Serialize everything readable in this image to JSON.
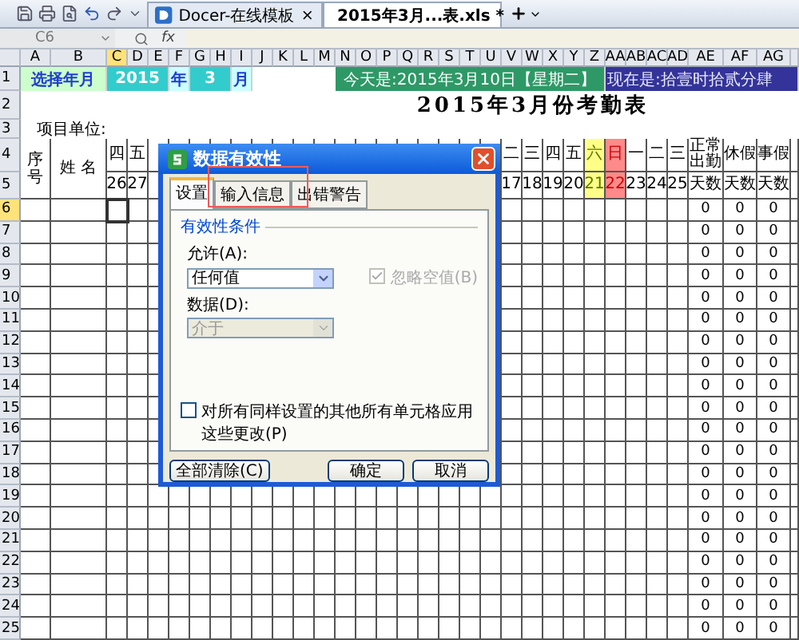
{
  "tabs": [
    {
      "label": "Docer-在线模板",
      "selected": false
    },
    {
      "label": "2015年3月...表.xls *",
      "selected": true
    }
  ],
  "name_box": "C6",
  "fx_label": "fx",
  "columns": [
    {
      "label": "A",
      "selected": false
    },
    {
      "label": "B",
      "selected": false
    },
    {
      "label": "C",
      "selected": true
    },
    {
      "label": "D",
      "selected": false
    },
    {
      "label": "E",
      "selected": false
    },
    {
      "label": "F",
      "selected": false
    },
    {
      "label": "G",
      "selected": false
    },
    {
      "label": "H",
      "selected": false
    },
    {
      "label": "I",
      "selected": false
    },
    {
      "label": "J",
      "selected": false
    },
    {
      "label": "K",
      "selected": false
    },
    {
      "label": "L",
      "selected": false
    },
    {
      "label": "M",
      "selected": false
    },
    {
      "label": "N",
      "selected": false
    },
    {
      "label": "O",
      "selected": false
    },
    {
      "label": "P",
      "selected": false
    },
    {
      "label": "Q",
      "selected": false
    },
    {
      "label": "R",
      "selected": false
    },
    {
      "label": "S",
      "selected": false
    },
    {
      "label": "T",
      "selected": false
    },
    {
      "label": "U",
      "selected": false
    },
    {
      "label": "V",
      "selected": false
    },
    {
      "label": "W",
      "selected": false
    },
    {
      "label": "X",
      "selected": false
    },
    {
      "label": "Y",
      "selected": false
    },
    {
      "label": "Z",
      "selected": false
    },
    {
      "label": "AA",
      "selected": false
    },
    {
      "label": "AB",
      "selected": false
    },
    {
      "label": "AC",
      "selected": false
    },
    {
      "label": "AD",
      "selected": false
    },
    {
      "label": "AE",
      "selected": false
    },
    {
      "label": "AF",
      "selected": false
    },
    {
      "label": "AG",
      "selected": false
    }
  ],
  "row_headers": [
    {
      "label": "1",
      "selected": false
    },
    {
      "label": "2",
      "selected": false
    },
    {
      "label": "3",
      "selected": false
    },
    {
      "label": "4",
      "selected": false
    },
    {
      "label": "5",
      "selected": false
    },
    {
      "label": "6",
      "selected": true
    },
    {
      "label": "7",
      "selected": false
    },
    {
      "label": "8",
      "selected": false
    },
    {
      "label": "9",
      "selected": false
    },
    {
      "label": "10",
      "selected": false
    },
    {
      "label": "11",
      "selected": false
    },
    {
      "label": "12",
      "selected": false
    },
    {
      "label": "13",
      "selected": false
    },
    {
      "label": "14",
      "selected": false
    },
    {
      "label": "15",
      "selected": false
    },
    {
      "label": "16",
      "selected": false
    },
    {
      "label": "17",
      "selected": false
    },
    {
      "label": "18",
      "selected": false
    },
    {
      "label": "19",
      "selected": false
    },
    {
      "label": "20",
      "selected": false
    },
    {
      "label": "21",
      "selected": false
    },
    {
      "label": "22",
      "selected": false
    },
    {
      "label": "23",
      "selected": false
    },
    {
      "label": "24",
      "selected": false
    },
    {
      "label": "25",
      "selected": false
    }
  ],
  "top_row": {
    "label": "选择年月",
    "year": "2015",
    "year_unit": "年",
    "month": "3",
    "month_unit": "月",
    "today": "今天是:2015年3月10日【星期二】",
    "now": "现在是:拾壹时拾贰分肆"
  },
  "title": "2015年3月份考勤表",
  "unit_label": "项目单位:",
  "seq_header": "序号",
  "name_header": "姓 名",
  "days_start": [
    {
      "weekday": "四",
      "date": "26",
      "kind": "weekday"
    },
    {
      "weekday": "五",
      "date": "27",
      "kind": "weekday"
    }
  ],
  "days_end": [
    {
      "weekday": "二",
      "date": "17",
      "kind": "weekday"
    },
    {
      "weekday": "三",
      "date": "18",
      "kind": "weekday"
    },
    {
      "weekday": "四",
      "date": "19",
      "kind": "weekday"
    },
    {
      "weekday": "五",
      "date": "20",
      "kind": "weekday"
    },
    {
      "weekday": "六",
      "date": "21",
      "kind": "saturday"
    },
    {
      "weekday": "日",
      "date": "22",
      "kind": "sunday"
    },
    {
      "weekday": "一",
      "date": "23",
      "kind": "weekday"
    },
    {
      "weekday": "二",
      "date": "24",
      "kind": "weekday"
    },
    {
      "weekday": "三",
      "date": "25",
      "kind": "weekday"
    }
  ],
  "summary_columns": [
    {
      "title": "正常出勤",
      "unit": "天数"
    },
    {
      "title": "休假",
      "unit": "天数"
    },
    {
      "title": "事假",
      "unit": "天数"
    }
  ],
  "records": [
    {
      "counts": [
        "0",
        "0",
        "0"
      ]
    },
    {
      "counts": [
        "0",
        "0",
        "0"
      ]
    },
    {
      "counts": [
        "0",
        "0",
        "0"
      ]
    },
    {
      "counts": [
        "0",
        "0",
        "0"
      ]
    },
    {
      "counts": [
        "0",
        "0",
        "0"
      ]
    },
    {
      "counts": [
        "0",
        "0",
        "0"
      ]
    },
    {
      "counts": [
        "0",
        "0",
        "0"
      ]
    },
    {
      "counts": [
        "0",
        "0",
        "0"
      ]
    },
    {
      "counts": [
        "0",
        "0",
        "0"
      ]
    },
    {
      "counts": [
        "0",
        "0",
        "0"
      ]
    },
    {
      "counts": [
        "0",
        "0",
        "0"
      ]
    },
    {
      "counts": [
        "0",
        "0",
        "0"
      ]
    },
    {
      "counts": [
        "0",
        "0",
        "0"
      ]
    },
    {
      "counts": [
        "0",
        "0",
        "0"
      ]
    },
    {
      "counts": [
        "0",
        "0",
        "0"
      ]
    },
    {
      "counts": [
        "0",
        "0",
        "0"
      ]
    },
    {
      "counts": [
        "0",
        "0",
        "0"
      ]
    },
    {
      "counts": [
        "0",
        "0",
        "0"
      ]
    },
    {
      "counts": [
        "0",
        "0",
        "0"
      ]
    },
    {
      "counts": [
        "0",
        "0",
        "0"
      ]
    }
  ],
  "dialog": {
    "title": "数据有效性",
    "tabs": [
      {
        "label": "设置",
        "selected": true
      },
      {
        "label": "输入信息",
        "selected": false
      },
      {
        "label": "出错警告",
        "selected": false
      }
    ],
    "group_label": "有效性条件",
    "allow_label": "允许(A):",
    "allow_value": "任何值",
    "ignore_blank": {
      "label": "忽略空值(B)",
      "checked": true,
      "disabled": true
    },
    "data_label": "数据(D):",
    "data_field": {
      "value": "介于",
      "disabled": true
    },
    "apply_all": {
      "label": "对所有同样设置的其他所有单元格应用这些更改(P)",
      "checked": false
    },
    "buttons": [
      "全部清除(C)",
      "确定",
      "取消"
    ]
  }
}
